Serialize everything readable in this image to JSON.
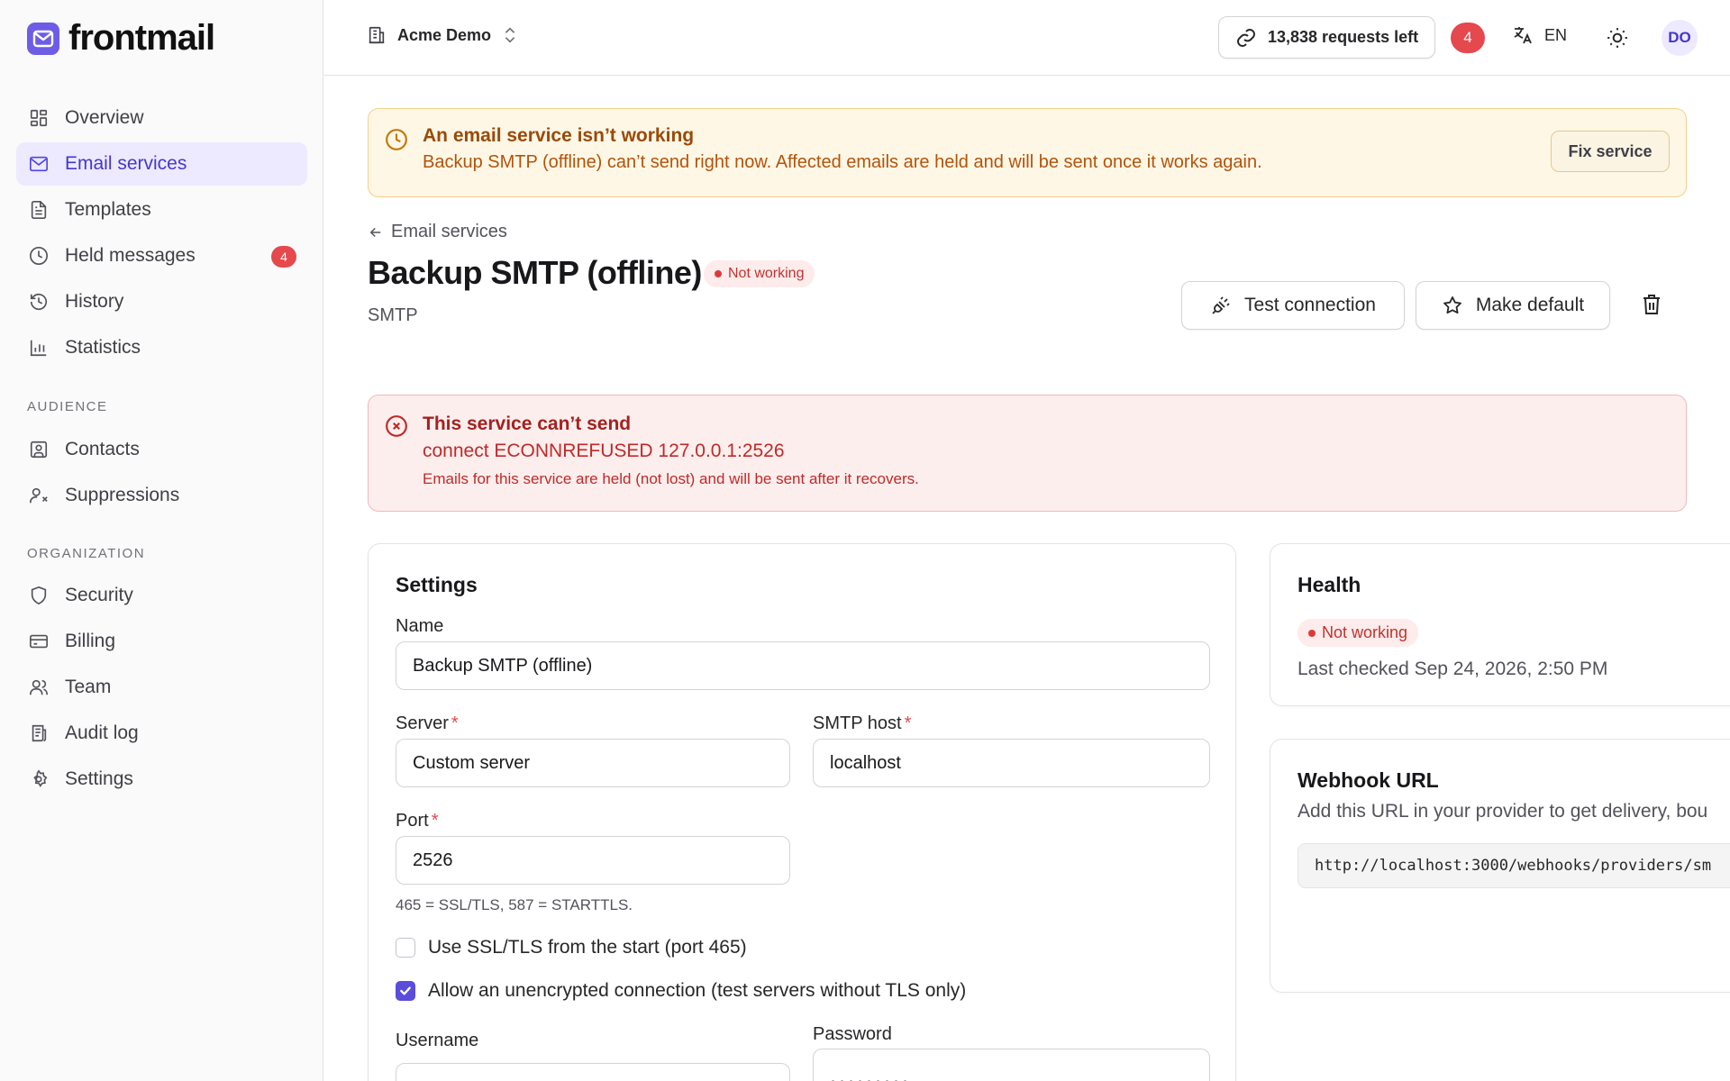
{
  "app": {
    "name": "frontmail"
  },
  "sidebar": {
    "items": [
      {
        "label": "Overview",
        "icon": "grid-icon"
      },
      {
        "label": "Email services",
        "icon": "mail-icon",
        "active": true
      },
      {
        "label": "Templates",
        "icon": "file-text-icon"
      },
      {
        "label": "Held messages",
        "icon": "clock-icon",
        "badge": "4"
      },
      {
        "label": "History",
        "icon": "history-icon"
      },
      {
        "label": "Statistics",
        "icon": "bar-chart-icon"
      }
    ],
    "audience_heading": "AUDIENCE",
    "audience_items": [
      {
        "label": "Contacts",
        "icon": "contact-icon"
      },
      {
        "label": "Suppressions",
        "icon": "user-x-icon"
      }
    ],
    "organization_heading": "ORGANIZATION",
    "organization_items": [
      {
        "label": "Security",
        "icon": "shield-icon"
      },
      {
        "label": "Billing",
        "icon": "credit-card-icon"
      },
      {
        "label": "Team",
        "icon": "users-icon"
      },
      {
        "label": "Audit log",
        "icon": "log-icon"
      },
      {
        "label": "Settings",
        "icon": "gear-icon"
      }
    ]
  },
  "header": {
    "workspace": "Acme Demo",
    "requests": "13,838 requests left",
    "notifications": "4",
    "language": "EN",
    "avatar": "DO"
  },
  "warning": {
    "title": "An email service isn’t working",
    "body": "Backup SMTP (offline) can’t send right now. Affected emails are held and will be sent once it works again.",
    "action": "Fix service"
  },
  "page": {
    "back_label": "Email services",
    "title": "Backup SMTP (offline)",
    "status": "Not working",
    "subtitle": "SMTP",
    "test_button": "Test connection",
    "default_button": "Make default"
  },
  "error": {
    "title": "This service can’t send",
    "message": "connect ECONNREFUSED 127.0.0.1:2526",
    "note": "Emails for this service are held (not lost) and will be sent after it recovers."
  },
  "settings": {
    "title": "Settings",
    "name_label": "Name",
    "name_value": "Backup SMTP (offline)",
    "server_label": "Server",
    "server_value": "Custom server",
    "host_label": "SMTP host",
    "host_value": "localhost",
    "port_label": "Port",
    "port_value": "2526",
    "port_hint": "465 = SSL/TLS, 587 = STARTTLS.",
    "ssl_label": "Use SSL/TLS from the start (port 465)",
    "ssl_checked": false,
    "unencrypted_label": "Allow an unencrypted connection (test servers without TLS only)",
    "unencrypted_checked": true,
    "username_label": "Username",
    "password_label": "Password",
    "password_value": "•••••••••",
    "required_mark": "*"
  },
  "health": {
    "title": "Health",
    "status": "Not working",
    "last_checked": "Last checked Sep 24, 2026, 2:50 PM"
  },
  "webhook": {
    "title": "Webhook URL",
    "description": "Add this URL in your provider to get delivery, bou",
    "url": "http://localhost:3000/webhooks/providers/sm"
  },
  "colors": {
    "accent": "#5b4cdb",
    "danger": "#e5484d",
    "warning_bg": "#fef7e6",
    "error_bg": "#fdeeee"
  }
}
